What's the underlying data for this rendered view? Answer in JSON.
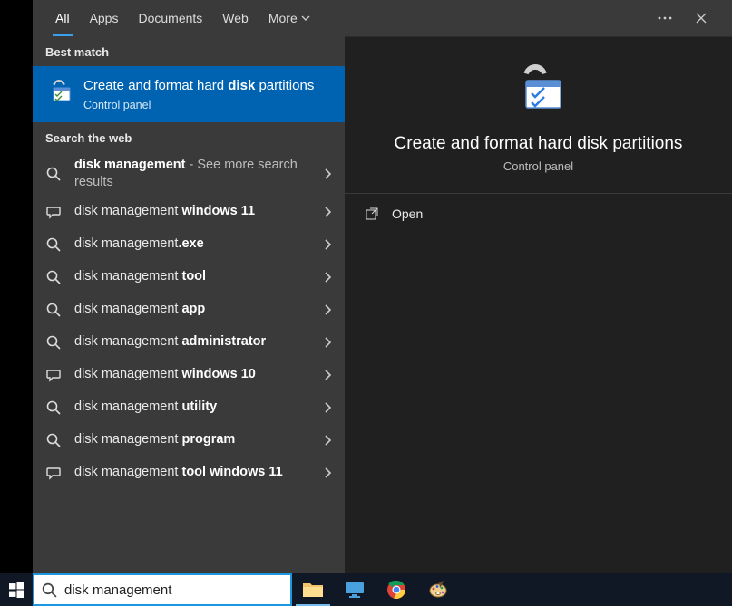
{
  "tabs": {
    "all": "All",
    "apps": "Apps",
    "documents": "Documents",
    "web": "Web",
    "more": "More"
  },
  "sections": {
    "best_match": "Best match",
    "web": "Search the web"
  },
  "best_match": {
    "title_pre": "Create and format hard ",
    "title_bold": "disk",
    "title_post": " partitions",
    "subtitle": "Control panel"
  },
  "web_results": [
    {
      "icon": "search",
      "pre": "",
      "bold": "disk management",
      "post": "",
      "extra": " - See more search results"
    },
    {
      "icon": "chat",
      "pre": "disk management ",
      "bold": "windows 11",
      "post": ""
    },
    {
      "icon": "search",
      "pre": "disk management",
      "bold": ".exe",
      "post": ""
    },
    {
      "icon": "search",
      "pre": "disk management ",
      "bold": "tool",
      "post": ""
    },
    {
      "icon": "search",
      "pre": "disk management ",
      "bold": "app",
      "post": ""
    },
    {
      "icon": "search",
      "pre": "disk management ",
      "bold": "administrator",
      "post": ""
    },
    {
      "icon": "chat",
      "pre": "disk management ",
      "bold": "windows 10",
      "post": ""
    },
    {
      "icon": "search",
      "pre": "disk management ",
      "bold": "utility",
      "post": ""
    },
    {
      "icon": "search",
      "pre": "disk management ",
      "bold": "program",
      "post": ""
    },
    {
      "icon": "chat",
      "pre": "disk management ",
      "bold": "tool windows 11",
      "post": ""
    }
  ],
  "preview": {
    "title": "Create and format hard disk partitions",
    "subtitle": "Control panel",
    "actions": {
      "open": "Open"
    }
  },
  "search": {
    "value": "disk management"
  }
}
